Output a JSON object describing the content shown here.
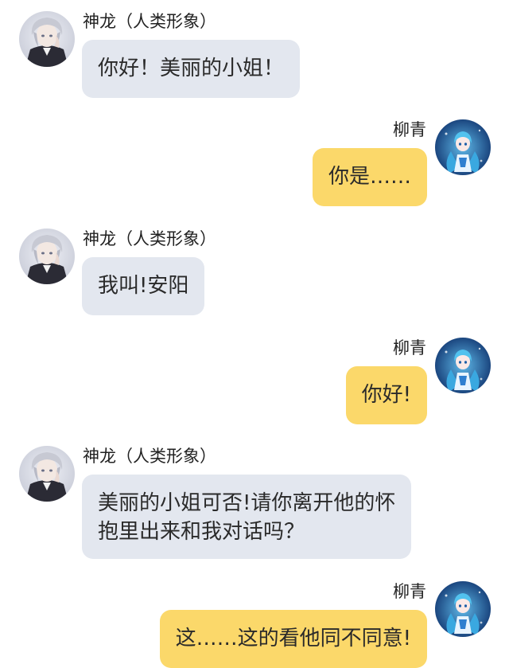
{
  "messages": [
    {
      "side": "left",
      "sender": "神龙（人类形象）",
      "lines": [
        "你好！美丽的小姐！"
      ]
    },
    {
      "side": "right",
      "sender": "柳青",
      "lines": [
        "你是……"
      ]
    },
    {
      "side": "left",
      "sender": "神龙（人类形象）",
      "lines": [
        "我叫!安阳"
      ]
    },
    {
      "side": "right",
      "sender": "柳青",
      "lines": [
        "你好!"
      ]
    },
    {
      "side": "left",
      "sender": "神龙（人类形象）",
      "lines": [
        "美丽的小姐可否!请你离开他的怀",
        "抱里出来和我对话吗？"
      ]
    },
    {
      "side": "right",
      "sender": "柳青",
      "lines": [
        "这……这的看他同不同意!"
      ]
    }
  ],
  "colors": {
    "left_bubble": "#e3e7ef",
    "right_bubble": "#fbd86a",
    "text": "#2a2a2a"
  },
  "avatars": {
    "left": "silver-haired-man-avatar",
    "right": "blue-haired-girl-avatar"
  }
}
